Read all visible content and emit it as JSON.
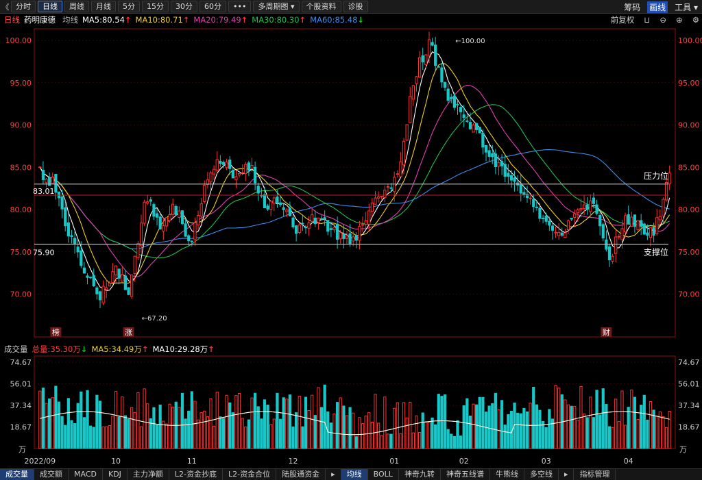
{
  "toolbar": {
    "back_glyph": "《",
    "tabs": [
      "分时",
      "日线",
      "周线",
      "月线",
      "5分",
      "15分",
      "30分",
      "60分",
      "•••",
      "多周期图 ▾",
      "个股资料",
      "诊股"
    ],
    "active_tab": 1,
    "right": [
      "筹码",
      "画线",
      "工具 ▾"
    ],
    "right_active": 1
  },
  "info": {
    "period": "日线",
    "name": "药明康德",
    "ma_label": "均线",
    "ma5": "MA5:80.54",
    "ma10": "MA10:80.71",
    "ma20": "MA20:79.49",
    "ma30": "MA30:80.30",
    "ma60": "MA60:85.48",
    "restore": "前复权",
    "colors": {
      "ma5": "#ffffff",
      "ma10": "#f0d020",
      "ma20": "#e040b0",
      "ma30": "#20c050",
      "ma60": "#3a8ef0",
      "up": "#ff3030",
      "down": "#18c8c8"
    }
  },
  "volume_info": {
    "label": "成交量",
    "total": "总量:35.30万",
    "ma5": "MA5:34.49万",
    "ma10": "MA10:29.28万"
  },
  "bottom_tabs": [
    "成交量",
    "成交额",
    "MACD",
    "KDJ",
    "主力净额",
    "L2-资金抄底",
    "L2-资金合位",
    "陆股通资金",
    "▸",
    "均线",
    "BOLL",
    "神奇九转",
    "神奇五线谱",
    "牛熊线",
    "多空线",
    "▸",
    "指标管理"
  ],
  "bottom_active": [
    0,
    9
  ],
  "chart_data": {
    "type": "candlestick",
    "price_axis": {
      "ticks": [
        100,
        95,
        90,
        85,
        80,
        75,
        70
      ],
      "labels": [
        "100.00",
        "95.00",
        "90.00",
        "85.00",
        "80.00",
        "75.00",
        "70.00"
      ]
    },
    "volume_axis": {
      "ticks": [
        74.67,
        56.01,
        37.34,
        18.67
      ],
      "labels": [
        "74.67",
        "56.01",
        "37.34",
        "18.67"
      ],
      "unit": "万"
    },
    "x_labels": [
      "2022/09",
      "10",
      "11",
      "12",
      "01",
      "02",
      "03",
      "04"
    ],
    "x_label_index": [
      0,
      24,
      48,
      80,
      112,
      134,
      160,
      186
    ],
    "annotations": {
      "high_label": "100.00",
      "low_label": "67.20",
      "resistance": {
        "value": 83.01,
        "label": "83.01",
        "side_label": "压力位"
      },
      "support": {
        "value": 75.9,
        "label": "75.90",
        "side_label": "支撑位"
      },
      "red_line_value": 81.7,
      "markers": [
        {
          "index": 5,
          "text": "榜"
        },
        {
          "index": 28,
          "text": "涨"
        },
        {
          "index": 179,
          "text": "财"
        }
      ]
    },
    "key_closes": [
      84.5,
      83.0,
      77.0,
      72.0,
      70.0,
      73.0,
      70.5,
      82.0,
      78.0,
      80.5,
      76.0,
      83.0,
      86.0,
      84.0,
      85.5,
      80.0,
      81.5,
      77.5,
      79.0,
      78.5,
      77.0,
      76.0,
      80.0,
      82.0,
      85.0,
      96.0,
      100.0,
      94.0,
      92.0,
      89.0,
      87.0,
      84.0,
      82.0,
      80.0,
      78.0,
      77.0,
      81.0,
      80.0,
      74.0,
      79.0,
      78.0,
      77.5,
      84.0
    ]
  }
}
